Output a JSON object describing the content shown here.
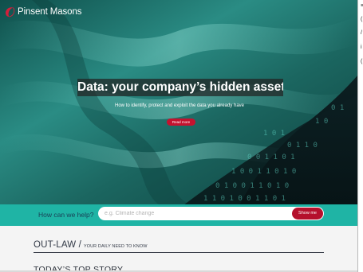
{
  "brand": {
    "name": "Pinsent Masons",
    "accent": "#c4122f"
  },
  "hero": {
    "headline": "Data: your company’s hidden asset",
    "subline": "How to identify, protect and exploit the data you already have",
    "cta_label": "Read more"
  },
  "help": {
    "label": "How can we help?",
    "placeholder": "e.g. Climate change",
    "button_label": "Show me",
    "band_color": "#1fb4a5"
  },
  "outlaw": {
    "title": "OUT-LAW",
    "separator": " / ",
    "tagline": "YOUR DAILY NEED TO KNOW",
    "top_story_heading": "TODAY’S TOP STORY"
  },
  "right_strip": {
    "chars": [
      "≡",
      "(",
      "/",
      "i",
      "("
    ]
  }
}
